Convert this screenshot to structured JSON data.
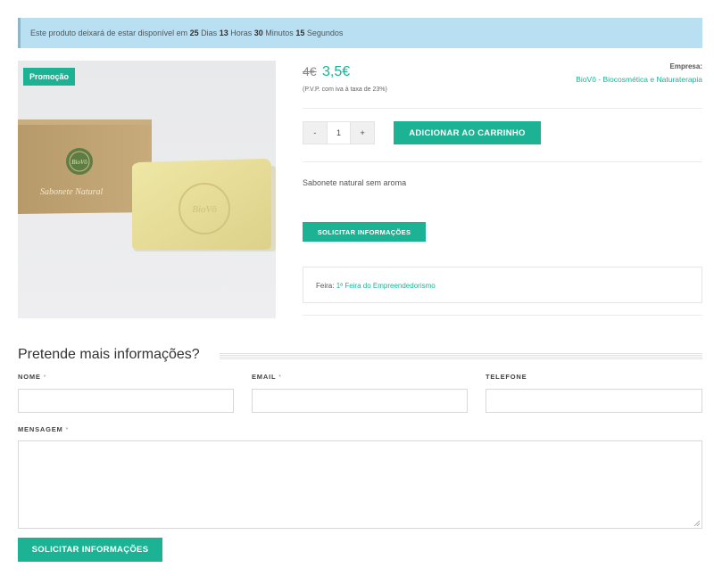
{
  "notice": {
    "prefix": "Este produto deixará de estar disponível em",
    "days_value": "25",
    "days_label": "Dias",
    "hours_value": "13",
    "hours_label": "Horas",
    "minutes_value": "30",
    "minutes_label": "Minutos",
    "seconds_value": "15",
    "seconds_label": "Segundos"
  },
  "product": {
    "badge": "Promoção",
    "image_label": "Sabonete Natural",
    "brand_mark": "BioVô",
    "price_old": "4€",
    "price_new": "3,5€",
    "price_note": "(P.V.P. com iva à taxa de 23%)",
    "company_label": "Empresa:",
    "company_name": "BioVô - Biocosmética e Naturaterapia",
    "quantity": "1",
    "minus_label": "-",
    "plus_label": "+",
    "add_to_cart": "ADICIONAR AO CARRINHO",
    "description": "Sabonete natural sem aroma",
    "request_info": "SOLICITAR INFORMAÇÕES",
    "fair_label": "Feira:",
    "fair_name": "1ª Feira do Empreendedorismo"
  },
  "form": {
    "title": "Pretende mais informações?",
    "name_label": "NOME",
    "email_label": "EMAIL",
    "phone_label": "TELEFONE",
    "message_label": "MENSAGEM",
    "required_mark": "*",
    "submit": "SOLICITAR INFORMAÇÕES"
  },
  "colors": {
    "accent": "#1bb394",
    "notice_bg": "#b9dff2"
  }
}
